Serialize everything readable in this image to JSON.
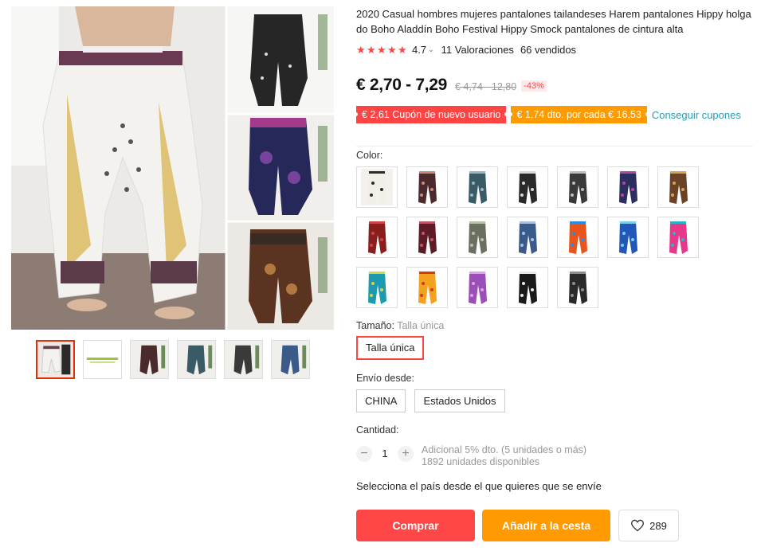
{
  "product": {
    "title": "2020 Casual hombres mujeres pantalones tailandeses Harem pantalones Hippy holgado Boho Aladdín Boho Festival Hippy Smock pantalones de cintura alta",
    "rating": "4.7",
    "reviews": "11 Valoraciones",
    "sold": "66 vendidos"
  },
  "price": {
    "current": "€ 2,70 - 7,29",
    "original": "€ 4,74 - 12,80",
    "discount": "-43%"
  },
  "coupons": {
    "new_user": "€ 2,61 Cupón de nuevo usuario",
    "per_amount": "€ 1,74 dto. por cada € 16,53",
    "get_link": "Conseguir cupones"
  },
  "color": {
    "label": "Color:",
    "swatches": [
      {
        "bg": "#f4f1ec",
        "pant": "#f2efe9",
        "accent": "#2b2b2b"
      },
      {
        "bg": "#ffffff",
        "pant": "#4a2a2c",
        "accent": "#c98a7a"
      },
      {
        "bg": "#ffffff",
        "pant": "#3a5a66",
        "accent": "#9bb7bd"
      },
      {
        "bg": "#ffffff",
        "pant": "#2a2a2a",
        "accent": "#d9d9d9"
      },
      {
        "bg": "#ffffff",
        "pant": "#3a3a3a",
        "accent": "#bdbdbd"
      },
      {
        "bg": "#ffffff",
        "pant": "#2c2f5e",
        "accent": "#b048a6"
      },
      {
        "bg": "#ffffff",
        "pant": "#6a4326",
        "accent": "#d6a35a"
      },
      {
        "bg": "#ffffff",
        "pant": "#8a1d1d",
        "accent": "#d04545"
      },
      {
        "bg": "#ffffff",
        "pant": "#5e1a26",
        "accent": "#c0566a"
      },
      {
        "bg": "#ffffff",
        "pant": "#6a7060",
        "accent": "#b8c0a6"
      },
      {
        "bg": "#ffffff",
        "pant": "#3a5a8a",
        "accent": "#a6c2e0"
      },
      {
        "bg": "#ffffff",
        "pant": "#e8541e",
        "accent": "#2d8adf"
      },
      {
        "bg": "#ffffff",
        "pant": "#2257b8",
        "accent": "#7ad0e6"
      },
      {
        "bg": "#ffffff",
        "pant": "#e8388a",
        "accent": "#2bb3c9"
      },
      {
        "bg": "#ffffff",
        "pant": "#1c9ab0",
        "accent": "#d9d441"
      },
      {
        "bg": "#ffffff",
        "pant": "#f2a21c",
        "accent": "#d23a1a"
      },
      {
        "bg": "#ffffff",
        "pant": "#9a4fb8",
        "accent": "#e2a1e6"
      },
      {
        "bg": "#ffffff",
        "pant": "#1a1a1a",
        "accent": "#e8e8e8"
      },
      {
        "bg": "#ffffff",
        "pant": "#2a2a2a",
        "accent": "#8c8c8c"
      }
    ]
  },
  "size": {
    "label": "Tamaño:",
    "selected_label": "Talla única",
    "option": "Talla única"
  },
  "shipping": {
    "label": "Envío desde:",
    "options": [
      "CHINA",
      "Estados Unidos"
    ],
    "note": "Selecciona el país desde el que quieres que se envíe"
  },
  "quantity": {
    "label": "Cantidad:",
    "minus": "−",
    "plus": "+",
    "value": "1",
    "extra_discount": "Adicional 5% dto. (5 unidades o más)",
    "available": "1892 unidades disponibles"
  },
  "actions": {
    "buy": "Comprar",
    "add_to_cart": "Añadir a la cesta",
    "wishlist_count": "289"
  },
  "colors": {
    "accent_red": "#ff4747",
    "accent_orange": "#ff9a00",
    "link": "#2a9bb6",
    "star": "#ff4444"
  }
}
